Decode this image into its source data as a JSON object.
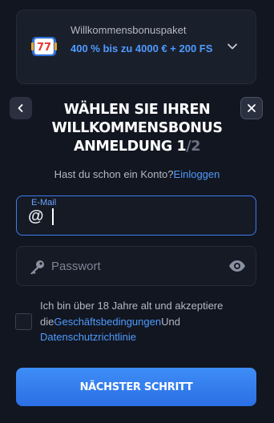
{
  "bonus": {
    "title": "Willkommensbonuspaket",
    "description": "400 % bis zu 4000 € + 200 FS",
    "icon": "slot-machine-icon"
  },
  "header": {
    "title_line1": "Wählen Sie Ihren",
    "title_line2": "Willkommensbonus",
    "step_label": "Anmeldung",
    "step_current": "1",
    "step_separator": "/",
    "step_total": "2"
  },
  "login": {
    "prompt": "Hast du schon ein Konto?",
    "link": "Einloggen"
  },
  "form": {
    "email_label": "E-Mail",
    "email_value": "",
    "password_placeholder": "Passwort",
    "password_value": ""
  },
  "terms": {
    "text_before": "Ich bin über 18 Jahre alt und akzeptiere die",
    "link1": "Geschäftsbedingungen",
    "text_middle": "Und",
    "link2": "Datenschutzrichtlinie",
    "checked": false
  },
  "actions": {
    "next_label": "Nächster Schritt",
    "back_icon": "chevron-left-icon",
    "close_icon": "close-icon"
  },
  "colors": {
    "background": "#121620",
    "accent": "#4f9bff",
    "button": "#3381f0"
  }
}
